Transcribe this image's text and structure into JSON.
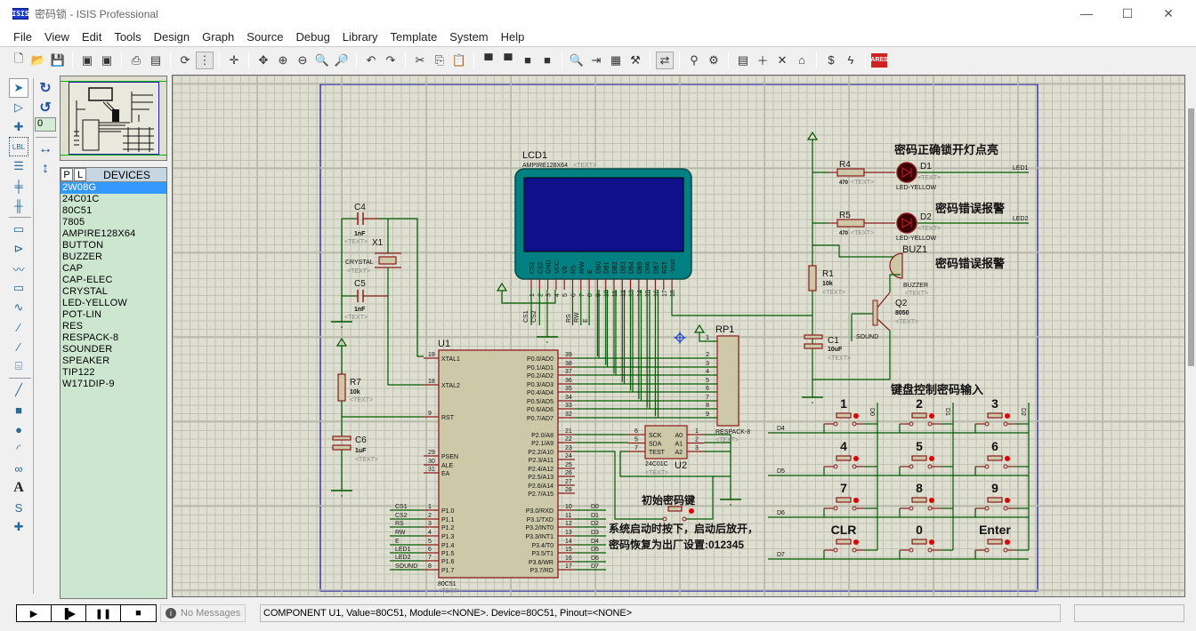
{
  "window": {
    "app_icon_text": "ISIS",
    "title": "密码锁 - ISIS Professional",
    "minimize": "—",
    "maximize": "☐",
    "close": "✕"
  },
  "menu": [
    "File",
    "View",
    "Edit",
    "Tools",
    "Design",
    "Graph",
    "Source",
    "Debug",
    "Library",
    "Template",
    "System",
    "Help"
  ],
  "toolbar": [
    {
      "name": "new-icon",
      "glyph": "🗋"
    },
    {
      "name": "open-icon",
      "glyph": "📂"
    },
    {
      "name": "save-icon",
      "glyph": "💾"
    },
    {
      "sep": true
    },
    {
      "name": "import-section-icon",
      "glyph": "▣"
    },
    {
      "name": "export-section-icon",
      "glyph": "▣"
    },
    {
      "sep": true
    },
    {
      "name": "print-icon",
      "glyph": "⎙"
    },
    {
      "name": "print-area-icon",
      "glyph": "▤"
    },
    {
      "sep": true
    },
    {
      "name": "redraw-icon",
      "glyph": "⟳"
    },
    {
      "name": "grid-icon",
      "glyph": "⋮",
      "active": true
    },
    {
      "sep": true
    },
    {
      "name": "origin-icon",
      "glyph": "✛"
    },
    {
      "sep": true
    },
    {
      "name": "pan-icon",
      "glyph": "✥"
    },
    {
      "name": "zoom-in-icon",
      "glyph": "⊕"
    },
    {
      "name": "zoom-out-icon",
      "glyph": "⊖"
    },
    {
      "name": "zoom-all-icon",
      "glyph": "🔍"
    },
    {
      "name": "zoom-area-icon",
      "glyph": "🔎"
    },
    {
      "sep": true
    },
    {
      "name": "undo-icon",
      "glyph": "↶"
    },
    {
      "name": "redo-icon",
      "glyph": "↷"
    },
    {
      "sep": true
    },
    {
      "name": "cut-icon",
      "glyph": "✂"
    },
    {
      "name": "copy-icon",
      "glyph": "⎘"
    },
    {
      "name": "paste-icon",
      "glyph": "📋"
    },
    {
      "sep": true
    },
    {
      "name": "block-copy-icon",
      "glyph": "▀"
    },
    {
      "name": "block-move-icon",
      "glyph": "▀"
    },
    {
      "name": "block-rotate-icon",
      "glyph": "■"
    },
    {
      "name": "block-delete-icon",
      "glyph": "■"
    },
    {
      "sep": true
    },
    {
      "name": "pick-device-icon",
      "glyph": "🔍"
    },
    {
      "name": "make-device-icon",
      "glyph": "⇥"
    },
    {
      "name": "packaging-tool-icon",
      "glyph": "▦"
    },
    {
      "name": "decompose-icon",
      "glyph": "⚒"
    },
    {
      "sep": true
    },
    {
      "name": "wire-autorouter-icon",
      "glyph": "⇄",
      "active": true
    },
    {
      "sep": true
    },
    {
      "name": "search-tag-icon",
      "glyph": "⚲"
    },
    {
      "name": "property-assignment-icon",
      "glyph": "⚙"
    },
    {
      "sep": true
    },
    {
      "name": "new-sheet-icon",
      "glyph": "▤"
    },
    {
      "name": "add-sheet-icon",
      "glyph": "＋"
    },
    {
      "name": "remove-sheet-icon",
      "glyph": "✕"
    },
    {
      "name": "goto-parent-icon",
      "glyph": "⌂"
    },
    {
      "sep": true
    },
    {
      "name": "bill-of-materials-icon",
      "glyph": "$"
    },
    {
      "name": "electrical-rule-check-icon",
      "glyph": "ϟ"
    },
    {
      "sep": true
    },
    {
      "name": "ares-icon",
      "glyph": "ARES"
    }
  ],
  "left_tools": [
    {
      "name": "selection-mode-icon",
      "glyph": "➤",
      "active": true
    },
    {
      "name": "component-mode-icon",
      "glyph": "▷"
    },
    {
      "name": "junction-dot-icon",
      "glyph": "✚"
    },
    {
      "name": "wire-label-icon",
      "glyph": "LBL"
    },
    {
      "name": "text-script-icon",
      "glyph": "☰"
    },
    {
      "name": "buses-icon",
      "glyph": "╪"
    },
    {
      "name": "subcircuit-icon",
      "glyph": "╫"
    },
    {
      "name": "terminals-icon",
      "glyph": "▭"
    },
    {
      "name": "device-pins-icon",
      "glyph": "⊳"
    },
    {
      "name": "graph-mode-icon",
      "glyph": "〰"
    },
    {
      "name": "tape-recorder-icon",
      "glyph": "▭"
    },
    {
      "name": "generator-icon",
      "glyph": "∿"
    },
    {
      "name": "voltage-probe-icon",
      "glyph": "⁄"
    },
    {
      "name": "current-probe-icon",
      "glyph": "⁄"
    },
    {
      "name": "virtual-instruments-icon",
      "glyph": "⌸"
    },
    {
      "name": "line-2d-icon",
      "glyph": "╱"
    },
    {
      "name": "box-2d-icon",
      "glyph": "■"
    },
    {
      "name": "circle-2d-icon",
      "glyph": "●"
    },
    {
      "name": "arc-2d-icon",
      "glyph": "◜"
    },
    {
      "name": "path-2d-icon",
      "glyph": "∞"
    },
    {
      "name": "text-2d-icon",
      "glyph": "A"
    },
    {
      "name": "symbol-2d-icon",
      "glyph": "S"
    },
    {
      "name": "marker-2d-icon",
      "glyph": "✚"
    }
  ],
  "rotation": {
    "rotate_cw": "↻",
    "rotate_ccw": "↺",
    "angle": "0",
    "mirror_h": "↔",
    "mirror_v": "↕"
  },
  "devices": {
    "tab_p": "P",
    "tab_l": "L",
    "title": "DEVICES",
    "items": [
      "2W08G",
      "24C01C",
      "80C51",
      "7805",
      "AMPIRE128X64",
      "BUTTON",
      "BUZZER",
      "CAP",
      "CAP-ELEC",
      "CRYSTAL",
      "LED-YELLOW",
      "POT-LIN",
      "RES",
      "RESPACK-8",
      "SOUNDER",
      "SPEAKER",
      "TIP122",
      "W171DIP-9"
    ],
    "selected": 0
  },
  "schematic": {
    "lcd": {
      "ref": "LCD1",
      "part": "AMPIRE128X64",
      "text": "<TEXT>",
      "pins": [
        "CS1",
        "CS2",
        "GND",
        "VCC",
        "V0",
        "RS",
        "R/W",
        "E",
        "DB0",
        "DB1",
        "DB2",
        "DB3",
        "DB4",
        "DB5",
        "DB6",
        "DB7",
        "RST",
        "-Vout"
      ],
      "nets": [
        "CS1",
        "CS2",
        "",
        "",
        "",
        "RS",
        "RW",
        "E"
      ]
    },
    "c4": {
      "ref": "C4",
      "value": "1nF",
      "text": "<TEXT>"
    },
    "x1": {
      "ref": "X1",
      "value": "CRYSTAL",
      "text": "<TEXT>"
    },
    "c5": {
      "ref": "C5",
      "value": "1nF",
      "text": "<TEXT>"
    },
    "r7": {
      "ref": "R7",
      "value": "10k",
      "text": "<TEXT>"
    },
    "c6": {
      "ref": "C6",
      "value": "1uF",
      "text": "<TEXT>"
    },
    "u1": {
      "ref": "U1",
      "part": "80C51",
      "text": "<TEXT>",
      "left_pins": [
        [
          "19",
          "XTAL1"
        ],
        [
          "18",
          "XTAL2"
        ],
        [
          "9",
          "RST"
        ],
        [
          "29",
          "PSEN"
        ],
        [
          "30",
          "ALE"
        ],
        [
          "31",
          "EA"
        ],
        [
          "1",
          "P1.0"
        ],
        [
          "2",
          "P1.1"
        ],
        [
          "3",
          "P1.2"
        ],
        [
          "4",
          "P1.3"
        ],
        [
          "5",
          "P1.4"
        ],
        [
          "6",
          "P1.5"
        ],
        [
          "7",
          "P1.6"
        ],
        [
          "8",
          "P1.7"
        ]
      ],
      "p1_nets": [
        "CS1",
        "CS2",
        "RS",
        "RW",
        "E",
        "LED1",
        "LED2",
        "SOUND"
      ],
      "right_pins": [
        [
          "39",
          "P0.0/AD0"
        ],
        [
          "38",
          "P0.1/AD1"
        ],
        [
          "37",
          "P0.2/AD2"
        ],
        [
          "36",
          "P0.3/AD3"
        ],
        [
          "35",
          "P0.4/AD4"
        ],
        [
          "34",
          "P0.5/AD5"
        ],
        [
          "33",
          "P0.6/AD6"
        ],
        [
          "32",
          "P0.7/AD7"
        ],
        [
          "21",
          "P2.0/A8"
        ],
        [
          "22",
          "P2.1/A9"
        ],
        [
          "23",
          "P2.2/A10"
        ],
        [
          "24",
          "P2.3/A11"
        ],
        [
          "25",
          "P2.4/A12"
        ],
        [
          "26",
          "P2.5/A13"
        ],
        [
          "27",
          "P2.6/A14"
        ],
        [
          "28",
          "P2.7/A15"
        ],
        [
          "10",
          "P3.0/RXD"
        ],
        [
          "11",
          "P3.1/TXD"
        ],
        [
          "12",
          "P3.2/INT0"
        ],
        [
          "13",
          "P3.3/INT1"
        ],
        [
          "14",
          "P3.4/T0"
        ],
        [
          "15",
          "P3.5/T1"
        ],
        [
          "16",
          "P3.6/WR"
        ],
        [
          "17",
          "P3.7/RD"
        ]
      ],
      "p3_nets": [
        "D0",
        "D1",
        "D2",
        "D3",
        "D4",
        "D5",
        "D6",
        "D7"
      ]
    },
    "rp1": {
      "ref": "RP1",
      "part": "RESPACK-8",
      "text": "<TEXT>",
      "pins": [
        "1",
        "2",
        "3",
        "4",
        "5",
        "6",
        "7",
        "8",
        "9"
      ]
    },
    "u2": {
      "ref": "U2",
      "part": "24C01C",
      "text": "<TEXT>",
      "left": [
        [
          "6",
          "SCK"
        ],
        [
          "5",
          "SDA"
        ],
        [
          "7",
          "TEST"
        ]
      ],
      "right": [
        [
          "1",
          "A0"
        ],
        [
          "2",
          "A1"
        ],
        [
          "3",
          "A2"
        ]
      ]
    },
    "r4": {
      "ref": "R4",
      "value": "470",
      "text": "<TEXT>"
    },
    "d1": {
      "ref": "D1",
      "part": "LED-YELLOW",
      "text": "<TEXT>",
      "net": "LED1"
    },
    "r5": {
      "ref": "R5",
      "value": "470",
      "text": "<TEXT>"
    },
    "d2": {
      "ref": "D2",
      "part": "LED-YELLOW",
      "text": "<TEXT>",
      "net": "LED2"
    },
    "buz1": {
      "ref": "BUZ1",
      "part": "BUZZER",
      "text": "<TEXT>"
    },
    "r1": {
      "ref": "R1",
      "value": "10k",
      "text": "<TEXT>"
    },
    "q2": {
      "ref": "Q2",
      "part": "8050",
      "text": "<TEXT>",
      "net": "SOUND"
    },
    "c1": {
      "ref": "C1",
      "value": "10uF",
      "text": "<TEXT>"
    },
    "notes": {
      "led_ok": "密码正确锁开灯点亮",
      "led_err": "密码错误报警",
      "buzzer_err": "密码错误报警",
      "keypad": "键盘控制密码输入",
      "init_key": "初始密码键",
      "reset_line1": "系统启动时按下，启动后放开，",
      "reset_line2": "密码恢复为出厂设置:012345"
    },
    "keypad": {
      "keys": [
        "1",
        "2",
        "3",
        "4",
        "5",
        "6",
        "7",
        "8",
        "9",
        "CLR",
        "0",
        "Enter"
      ],
      "col_nets": [
        "D0",
        "D1",
        "D2"
      ],
      "row_nets": [
        "D4",
        "D5",
        "D6",
        "D7"
      ]
    }
  },
  "status": {
    "sim_buttons": [
      {
        "name": "play-button",
        "glyph": "▶"
      },
      {
        "name": "step-button",
        "glyph": "▐▶"
      },
      {
        "name": "pause-button",
        "glyph": "❚❚"
      },
      {
        "name": "stop-button",
        "glyph": "■"
      }
    ],
    "messages": "No Messages",
    "text": "COMPONENT U1, Value=80C51, Module=<NONE>. Device=80C51, Pinout=<NONE>"
  }
}
